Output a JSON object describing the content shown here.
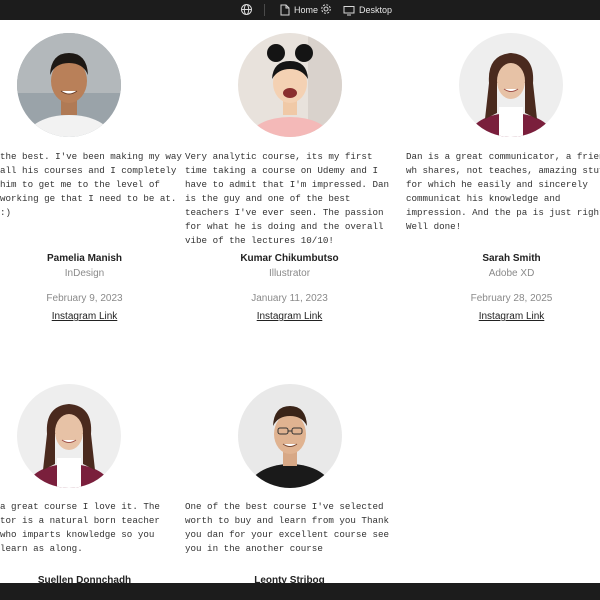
{
  "toolbar": {
    "home_label": "Home",
    "desktop_label": "Desktop"
  },
  "testimonials": [
    {
      "quote": "the best. I've been making my way all his courses and I completely him to get me to the level of working ge that I need to be at. :)",
      "name": "Pamelia Manish",
      "course": "InDesign",
      "date": "February 9, 2023",
      "link": "Instagram Link"
    },
    {
      "quote": "Very analytic course, its my first time taking a course on Udemy and I have to admit that I'm impressed. Dan is the guy and one of the best teachers I've ever seen. The passion for what he is doing and the overall vibe of the lectures 10/10!",
      "name": "Kumar Chikumbutso",
      "course": "Illustrator",
      "date": "January 11, 2023",
      "link": "Instagram Link"
    },
    {
      "quote": "Dan is a great communicator, a friend wh shares, not teaches, amazing stuff for which he easily and sincerely communicat his knowledge and impression. And the pa is just right. Well done!",
      "name": "Sarah Smith",
      "course": "Adobe XD",
      "date": "February 28, 2025",
      "link": "Instagram Link"
    },
    {
      "quote": "a great course I love it. The tor is a natural born teacher who imparts knowledge so you learn as along.",
      "name": "Suellen Donnchadh"
    },
    {
      "quote": "One of the best course I've selected worth to buy and learn from you Thank you dan for your excellent course see you in the another course",
      "name": "Leonty Stribog"
    }
  ],
  "colors": {
    "topbar_bg": "#1c1c1c",
    "muted_text": "#8a8a8a"
  }
}
